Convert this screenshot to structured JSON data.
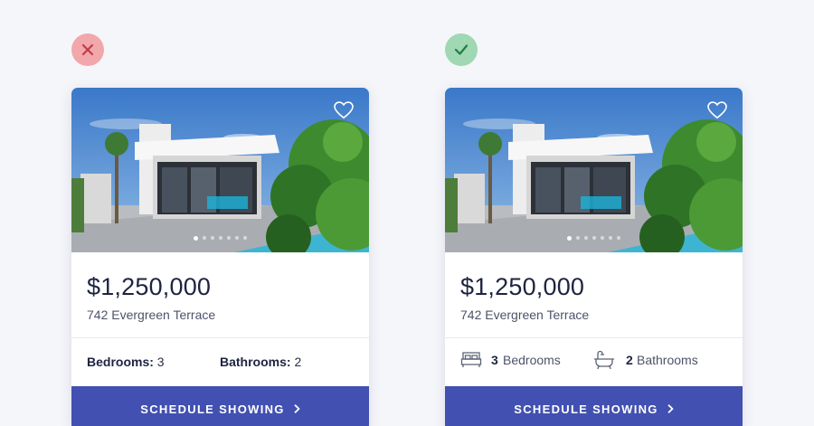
{
  "badges": {
    "bad": {
      "icon": "x-icon",
      "color": "#f2a7ab"
    },
    "good": {
      "icon": "check-icon",
      "color": "#9fd8b2"
    }
  },
  "cards": {
    "bad": {
      "price": "$1,250,000",
      "address": "742 Evergreen Terrace",
      "bedrooms_label": "Bedrooms:",
      "bedrooms_value": "3",
      "bathrooms_label": "Bathrooms:",
      "bathrooms_value": "2",
      "cta": "SCHEDULE SHOWING",
      "cta_icon": "chevron-right-icon"
    },
    "good": {
      "price": "$1,250,000",
      "address": "742 Evergreen Terrace",
      "bedrooms_value": "3",
      "bedrooms_label": "Bedrooms",
      "bedrooms_icon": "bed-icon",
      "bathrooms_value": "2",
      "bathrooms_label": "Bathrooms",
      "bathrooms_icon": "bathtub-icon",
      "cta": "SCHEDULE SHOWING",
      "cta_icon": "chevron-right-icon"
    }
  },
  "carousel": {
    "total": 7,
    "active": 1
  },
  "colors": {
    "accent": "#4250b1",
    "price": "#1e2440",
    "text": "#4d5468"
  }
}
